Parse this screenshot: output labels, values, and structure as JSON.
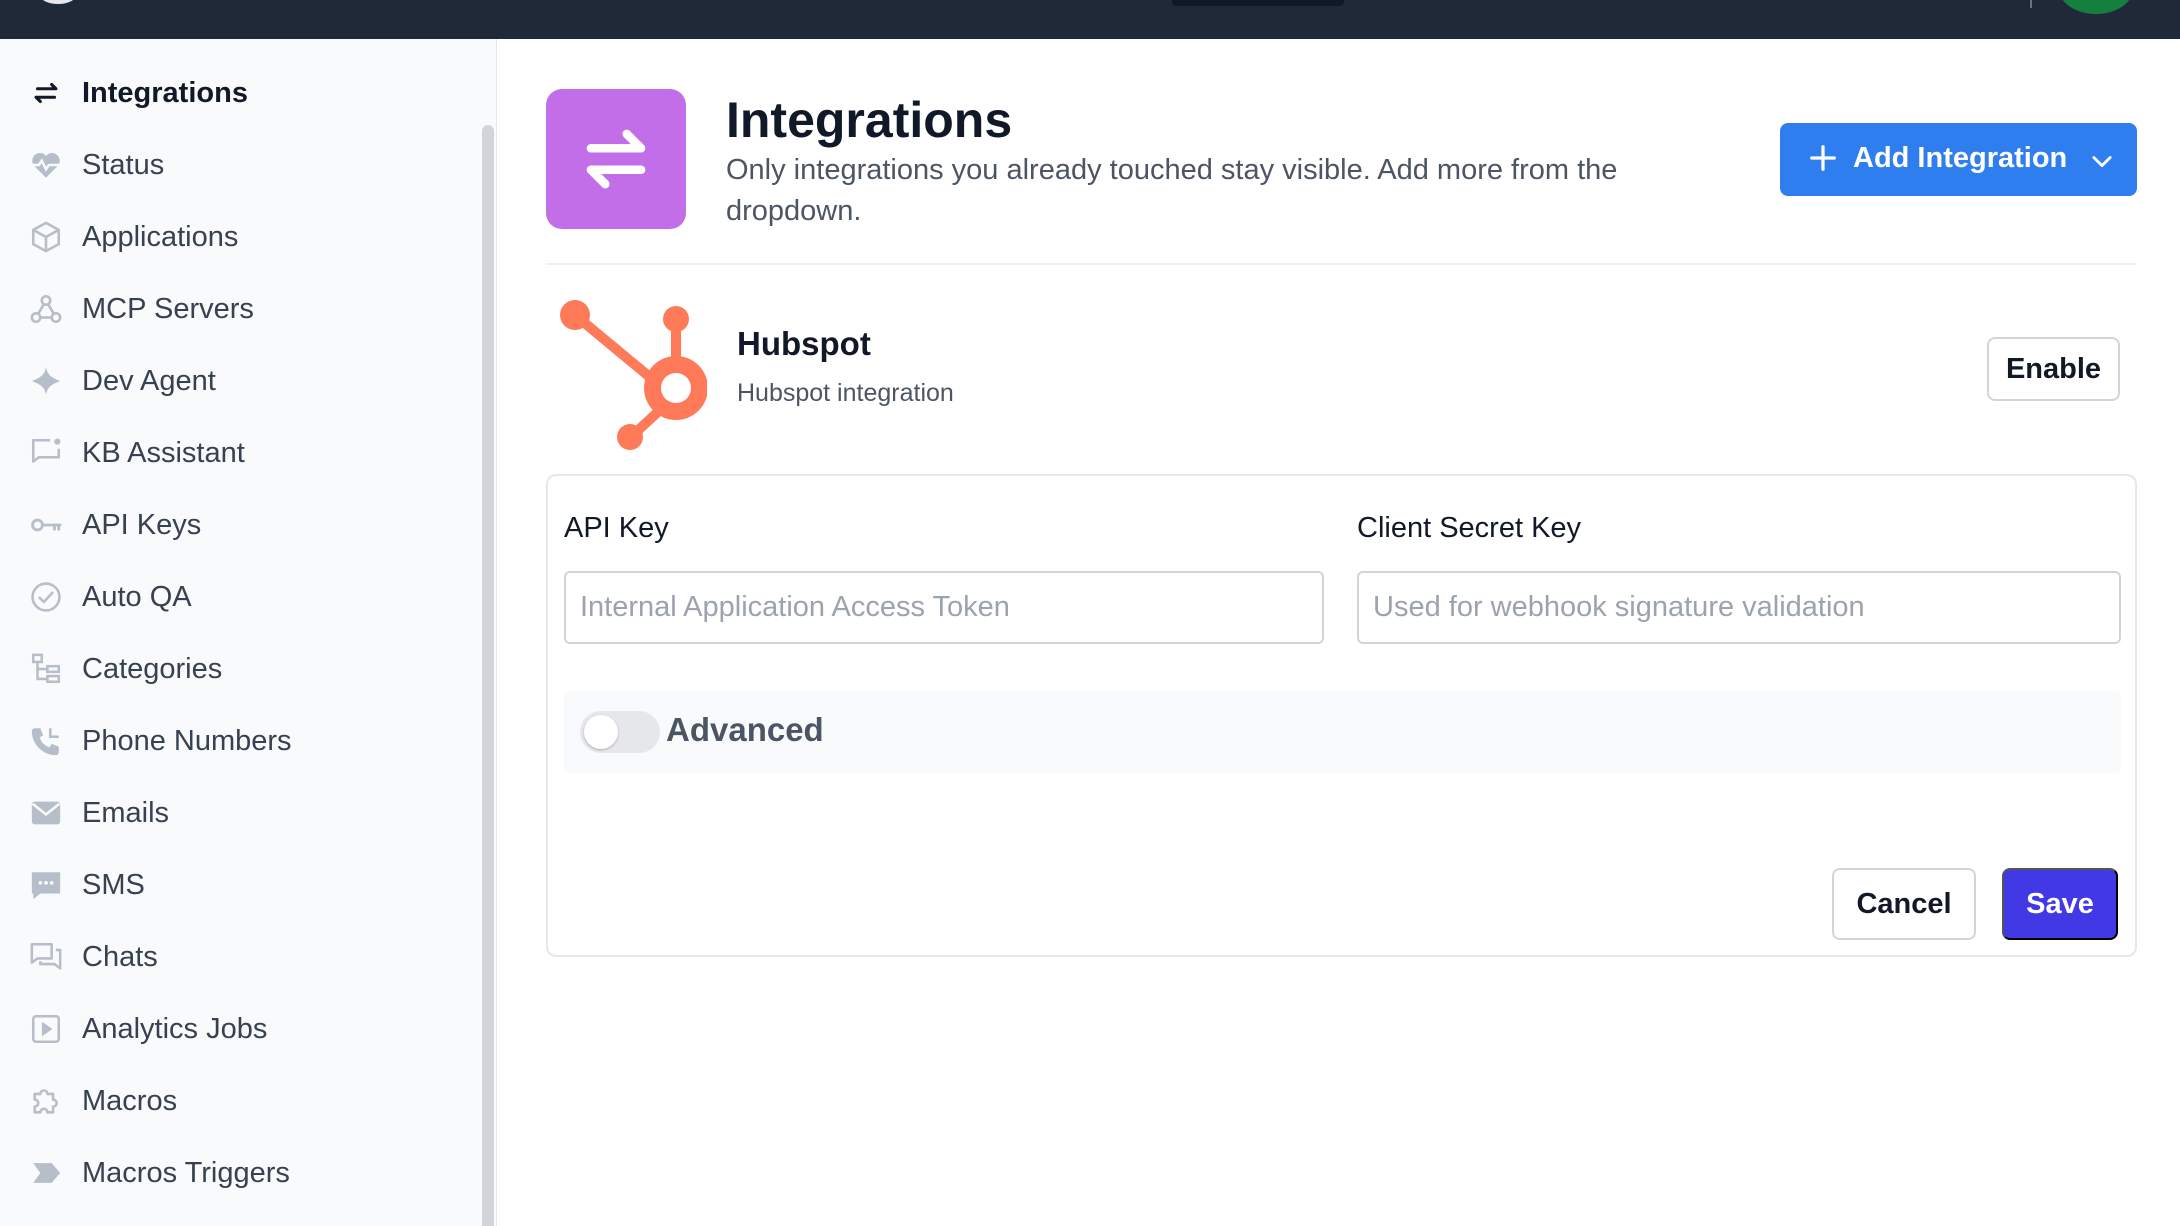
{
  "colors": {
    "topbar": "#1f2937",
    "integrations_icon_bg": "#c26ee8",
    "add_button": "#2f7ef0",
    "save_button": "#4338e6",
    "hubspot_orange": "#ff7a59"
  },
  "sidebar": {
    "items": [
      {
        "label": "Integrations",
        "icon": "arrows-exchange-icon",
        "active": true
      },
      {
        "label": "Status",
        "icon": "heart-pulse-icon"
      },
      {
        "label": "Applications",
        "icon": "cube-icon"
      },
      {
        "label": "MCP Servers",
        "icon": "webhook-icon"
      },
      {
        "label": "Dev Agent",
        "icon": "sparkle-icon"
      },
      {
        "label": "KB Assistant",
        "icon": "message-square-dot-icon"
      },
      {
        "label": "API Keys",
        "icon": "key-icon"
      },
      {
        "label": "Auto QA",
        "icon": "check-circle-icon"
      },
      {
        "label": "Categories",
        "icon": "hierarchy-icon"
      },
      {
        "label": "Phone Numbers",
        "icon": "phone-icon"
      },
      {
        "label": "Emails",
        "icon": "envelope-icon"
      },
      {
        "label": "SMS",
        "icon": "chat-bubble-dots-icon"
      },
      {
        "label": "Chats",
        "icon": "chats-icon"
      },
      {
        "label": "Analytics Jobs",
        "icon": "play-square-icon"
      },
      {
        "label": "Macros",
        "icon": "puzzle-icon"
      },
      {
        "label": "Macros Triggers",
        "icon": "chevron-tag-icon"
      }
    ]
  },
  "header": {
    "title": "Integrations",
    "subtitle": "Only integrations you already touched stay visible. Add more from the dropdown.",
    "add_button_label": "Add Integration"
  },
  "integration": {
    "name": "Hubspot",
    "description": "Hubspot integration",
    "enable_label": "Enable",
    "fields": {
      "api_key_label": "API Key",
      "api_key_placeholder": "Internal Application Access Token",
      "client_secret_label": "Client Secret Key",
      "client_secret_placeholder": "Used for webhook signature validation"
    },
    "advanced_label": "Advanced",
    "advanced_enabled": false,
    "cancel_label": "Cancel",
    "save_label": "Save"
  }
}
